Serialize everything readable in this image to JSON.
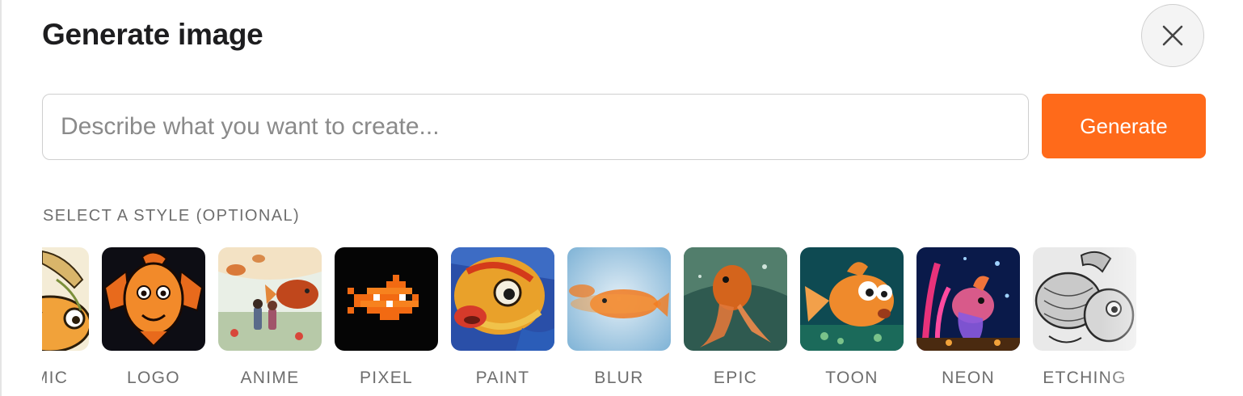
{
  "dialog": {
    "title": "Generate image",
    "close_icon": "close-icon"
  },
  "prompt": {
    "placeholder": "Describe what you want to create...",
    "value": ""
  },
  "generate_button": {
    "label": "Generate",
    "color": "#ff6a1a"
  },
  "style_section": {
    "label": "SELECT A STYLE (OPTIONAL)",
    "styles": [
      {
        "label": "COMIC",
        "thumbnail": "goldfish-comic"
      },
      {
        "label": "LOGO",
        "thumbnail": "goldfish-logo"
      },
      {
        "label": "ANIME",
        "thumbnail": "goldfish-anime"
      },
      {
        "label": "PIXEL",
        "thumbnail": "goldfish-pixel"
      },
      {
        "label": "PAINT",
        "thumbnail": "goldfish-paint"
      },
      {
        "label": "BLUR",
        "thumbnail": "goldfish-blur"
      },
      {
        "label": "EPIC",
        "thumbnail": "goldfish-epic"
      },
      {
        "label": "TOON",
        "thumbnail": "goldfish-toon"
      },
      {
        "label": "NEON",
        "thumbnail": "goldfish-neon"
      },
      {
        "label": "ETCHING",
        "thumbnail": "goldfish-etching"
      }
    ]
  }
}
